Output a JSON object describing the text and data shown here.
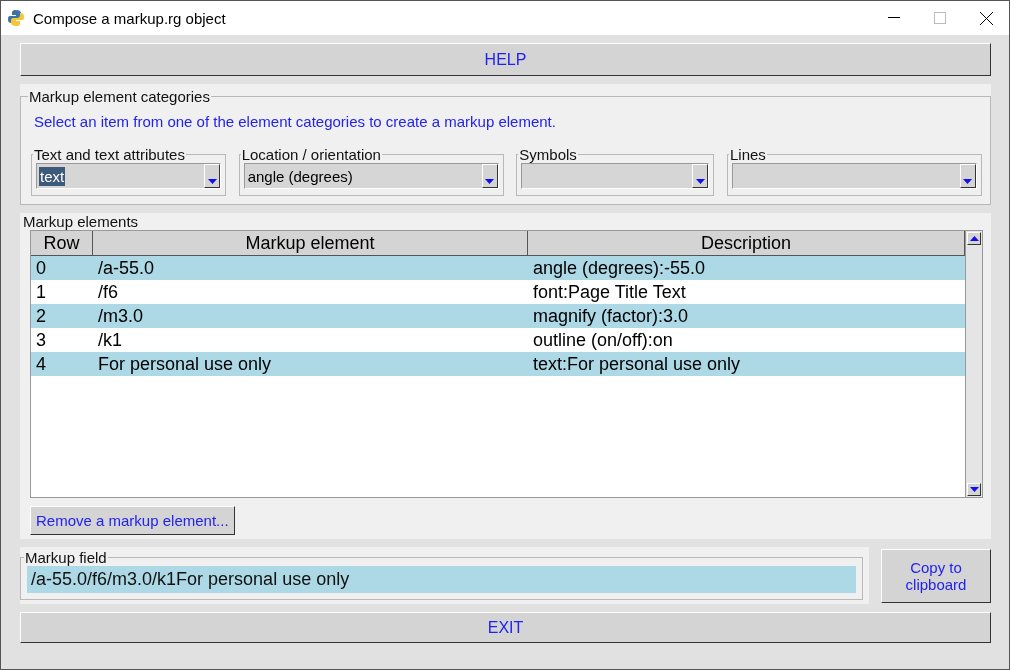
{
  "window": {
    "title": "Compose a markup.rg object"
  },
  "help_button": "HELP",
  "categories": {
    "title": "Markup element categories",
    "hint": "Select an item from one of the element categories to create a markup element.",
    "dropdowns": [
      {
        "label": "Text and text attributes",
        "value": "text",
        "highlighted": true
      },
      {
        "label": "Location / orientation",
        "value": "angle (degrees)",
        "highlighted": false
      },
      {
        "label": "Symbols"
      },
      {
        "label": "Lines"
      }
    ]
  },
  "elements": {
    "title": "Markup elements",
    "columns": [
      "Row",
      "Markup element",
      "Description"
    ],
    "rows": [
      [
        "0",
        "/a-55.0",
        "angle (degrees):-55.0"
      ],
      [
        "1",
        "/f6",
        "font:Page Title Text"
      ],
      [
        "2",
        "/m3.0",
        "magnify (factor):3.0"
      ],
      [
        "3",
        "/k1",
        "outline (on/off):on"
      ],
      [
        "4",
        "For personal use only",
        "text:For personal use only"
      ]
    ],
    "remove_button": "Remove a markup element..."
  },
  "markup_field": {
    "title": "Markup field",
    "value": "/a-55.0/f6/m3.0/k1For personal use only"
  },
  "copy_button": "Copy to clipboard",
  "exit_button": "EXIT"
}
